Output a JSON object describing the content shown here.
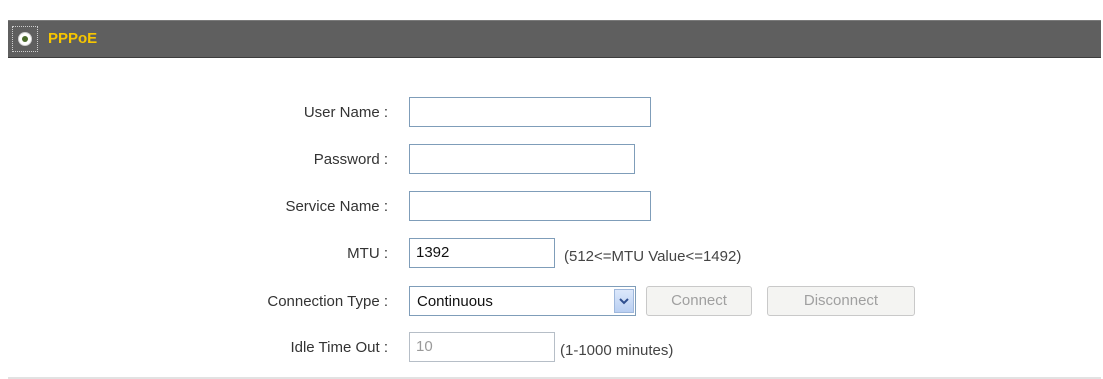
{
  "section": {
    "title": "PPPoE"
  },
  "form": {
    "user_name": {
      "label": "User Name :",
      "value": ""
    },
    "password": {
      "label": "Password :",
      "value": ""
    },
    "service_name": {
      "label": "Service Name :",
      "value": ""
    },
    "mtu": {
      "label": "MTU :",
      "value": "1392",
      "hint": "(512<=MTU Value<=1492)"
    },
    "connection_type": {
      "label": "Connection Type :",
      "selected": "Continuous",
      "connect_label": "Connect",
      "disconnect_label": "Disconnect"
    },
    "idle_time_out": {
      "label": "Idle Time Out :",
      "value": "10",
      "hint": "(1-1000 minutes)"
    }
  },
  "colors": {
    "header_bg": "#5f5f5f",
    "title": "#f7c600",
    "input_border": "#7f9db9"
  },
  "icons": {
    "section": "radio-selected-icon",
    "dropdown": "chevron-down-icon"
  }
}
